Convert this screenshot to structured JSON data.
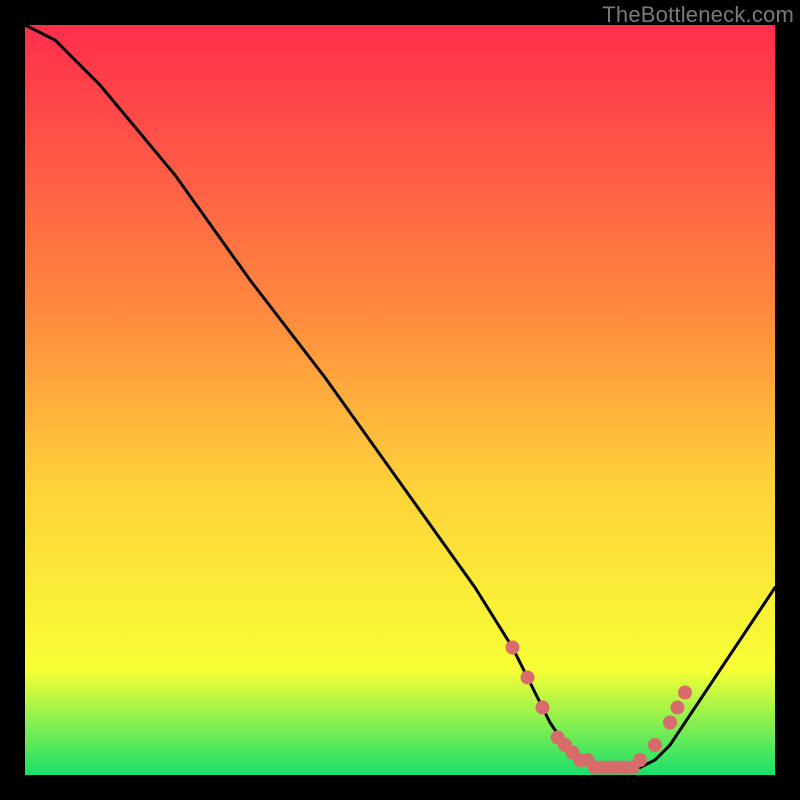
{
  "attribution": "TheBottleneck.com",
  "colors": {
    "frame": "#000000",
    "curve": "#000000",
    "marker": "#d86b6b",
    "gradient_top": "#ff2d4d",
    "gradient_mid1": "#ff893f",
    "gradient_mid2": "#ffd33a",
    "gradient_mid3": "#f7ff35",
    "gradient_bottom": "#19e06a"
  },
  "chart_data": {
    "type": "line",
    "title": "",
    "xlabel": "",
    "ylabel": "",
    "xlim": [
      0,
      100
    ],
    "ylim": [
      0,
      100
    ],
    "series": [
      {
        "name": "bottleneck-curve",
        "x": [
          0,
          4,
          7,
          10,
          20,
          30,
          40,
          50,
          60,
          65,
          68,
          70,
          72,
          74,
          76,
          78,
          80,
          82,
          84,
          86,
          88,
          92,
          96,
          100
        ],
        "y": [
          100,
          98,
          95,
          92,
          80,
          66,
          53,
          39,
          25,
          17,
          11,
          7,
          4,
          2,
          1,
          1,
          1,
          1,
          2,
          4,
          7,
          13,
          19,
          25
        ]
      }
    ],
    "markers": {
      "name": "highlight-points",
      "x": [
        65,
        67,
        69,
        71,
        72,
        73,
        74,
        75,
        76,
        77,
        78,
        79,
        80,
        81,
        82,
        84,
        86,
        87,
        88
      ],
      "y": [
        17,
        13,
        9,
        5,
        4,
        3,
        2,
        2,
        1,
        1,
        1,
        1,
        1,
        1,
        2,
        4,
        7,
        9,
        11
      ]
    }
  }
}
